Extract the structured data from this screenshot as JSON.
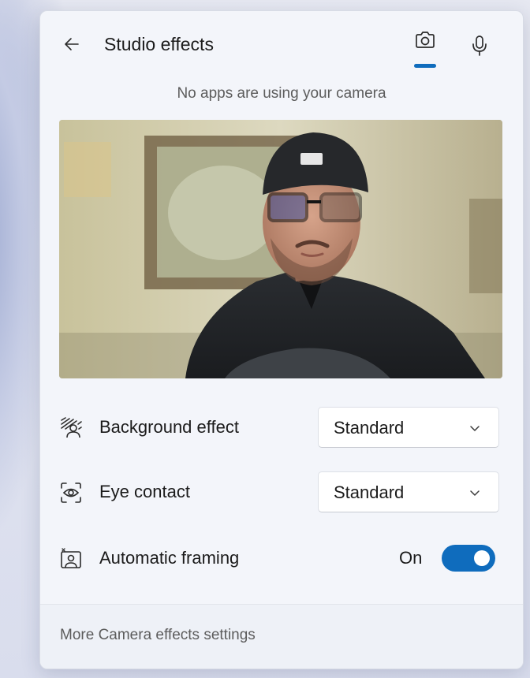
{
  "header": {
    "title": "Studio effects",
    "tabs": [
      {
        "icon": "camera-icon",
        "selected": true
      },
      {
        "icon": "microphone-icon",
        "selected": false
      }
    ]
  },
  "status": "No apps are using your camera",
  "settings": {
    "background_effect": {
      "label": "Background effect",
      "value": "Standard",
      "icon": "background-blur-icon"
    },
    "eye_contact": {
      "label": "Eye contact",
      "value": "Standard",
      "icon": "eye-contact-icon"
    },
    "automatic_framing": {
      "label": "Automatic framing",
      "state_label": "On",
      "enabled": true,
      "icon": "framing-icon"
    }
  },
  "footer": {
    "link": "More Camera effects settings"
  },
  "colors": {
    "accent": "#0f6cbd",
    "panel_bg": "#f3f5fa",
    "text": "#1b1b1b",
    "secondary_text": "#5c5c5c"
  }
}
